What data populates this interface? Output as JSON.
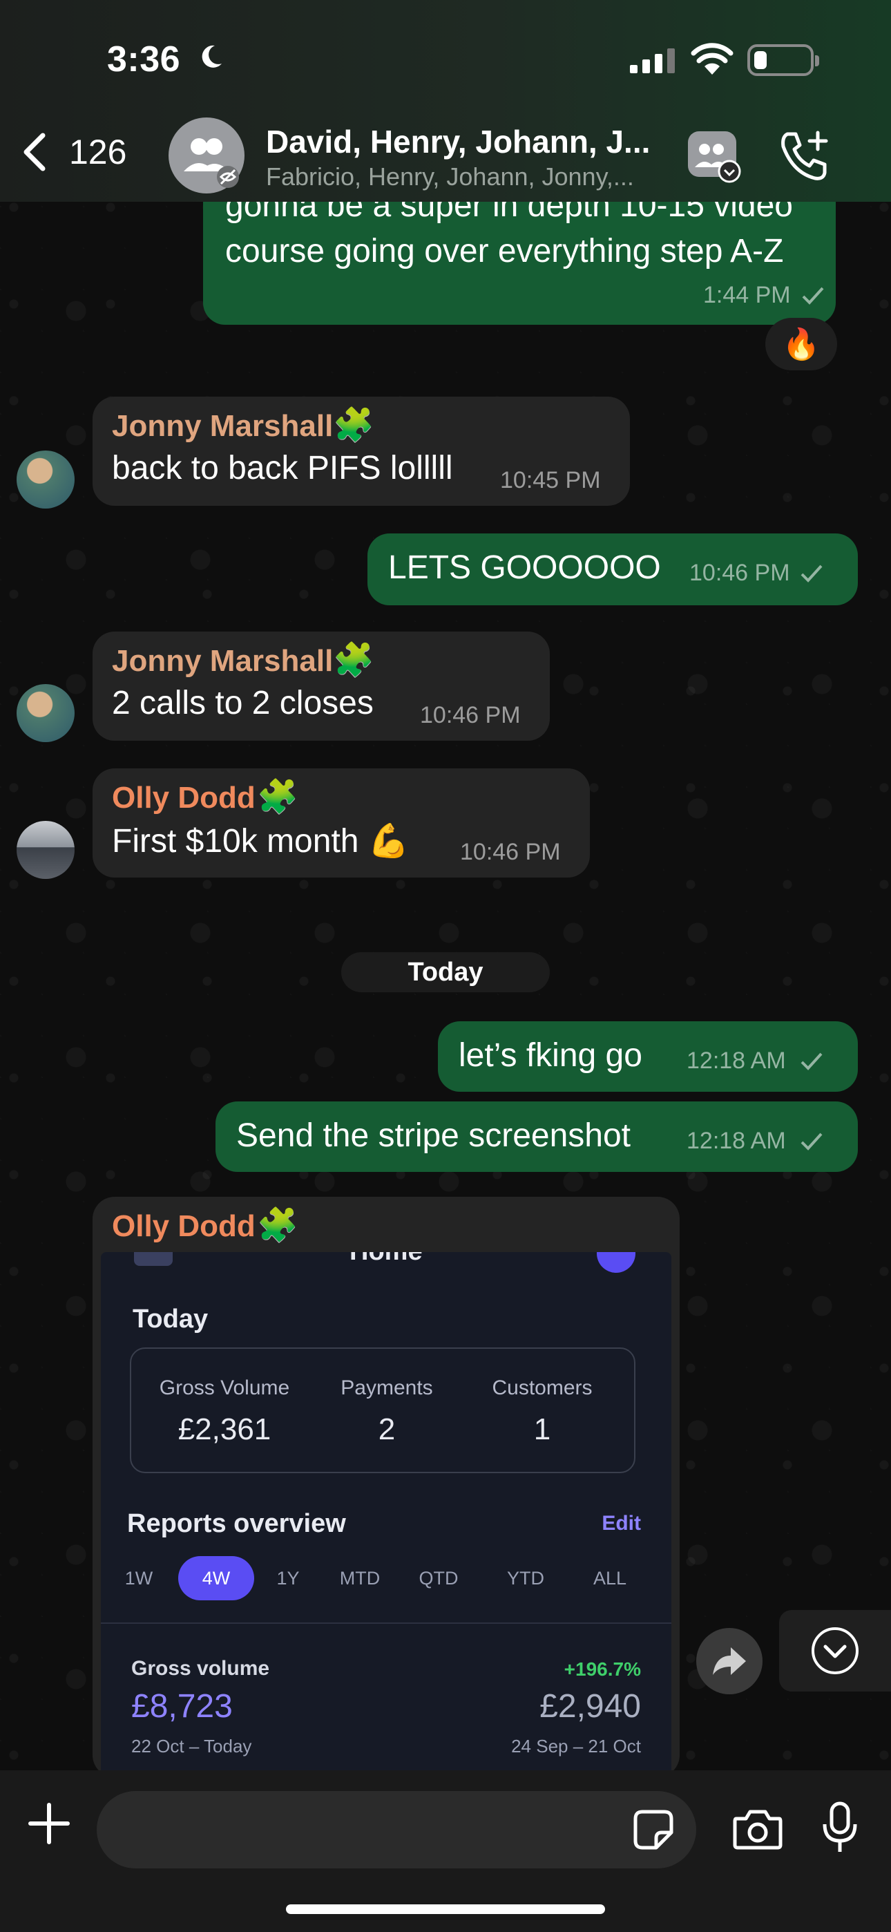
{
  "status_bar": {
    "time": "3:36"
  },
  "header": {
    "back_count": "126",
    "title": "David, Henry, Johann, J...",
    "subtitle": "Fabricio, Henry, Johann, Jonny,..."
  },
  "messages": [
    {
      "type": "out",
      "text_line1": "gonna be a super in depth 10-15 video",
      "text_line2": "course going over everything step A-Z",
      "time": "1:44 PM",
      "reaction": "🔥"
    },
    {
      "type": "in",
      "sender": "Jonny Marshall",
      "sender_badge": "🧩",
      "text": "back to back PIFS lolllll",
      "time": "10:45 PM"
    },
    {
      "type": "out",
      "text": "LETS GOOOOOO",
      "time": "10:46 PM"
    },
    {
      "type": "in",
      "sender": "Jonny Marshall",
      "sender_badge": "🧩",
      "text": "2 calls to 2 closes",
      "time": "10:46 PM"
    },
    {
      "type": "in",
      "sender": "Olly Dodd",
      "sender_badge": "🧩",
      "text": "First $10k month 💪",
      "time": "10:46 PM"
    },
    {
      "type": "out",
      "text": "let’s fking go",
      "time": "12:18 AM"
    },
    {
      "type": "out",
      "text": "Send the stripe screenshot",
      "time": "12:18 AM"
    },
    {
      "type": "in",
      "sender": "Olly Dodd",
      "sender_badge": "🧩"
    }
  ],
  "date_separator": "Today",
  "stripe_screenshot": {
    "header_partial": "Home",
    "today_label": "Today",
    "stats": [
      {
        "label": "Gross Volume",
        "value": "£2,361"
      },
      {
        "label": "Payments",
        "value": "2"
      },
      {
        "label": "Customers",
        "value": "1"
      }
    ],
    "reports_label": "Reports overview",
    "edit_label": "Edit",
    "ranges": [
      "1W",
      "4W",
      "1Y",
      "MTD",
      "QTD",
      "YTD",
      "ALL"
    ],
    "active_range": "4W",
    "gross_volume_label": "Gross volume",
    "change_pct": "+196.7%",
    "current_value": "£8,723",
    "previous_value": "£2,940",
    "current_period": "22 Oct – Today",
    "previous_period": "24 Sep – 21 Oct"
  },
  "colors": {
    "outgoing_bubble": "#155c33",
    "incoming_bubble": "#242424",
    "sender_jonny": "#e0a57f",
    "sender_olly": "#f08a5d",
    "stripe_accent": "#5a4df3"
  },
  "icons": [
    "back-chevron-icon",
    "group-avatar-icon",
    "group-info-icon",
    "add-call-icon",
    "check-icon",
    "forward-icon",
    "scroll-down-icon",
    "plus-icon",
    "sticker-icon",
    "camera-icon",
    "mic-icon"
  ]
}
